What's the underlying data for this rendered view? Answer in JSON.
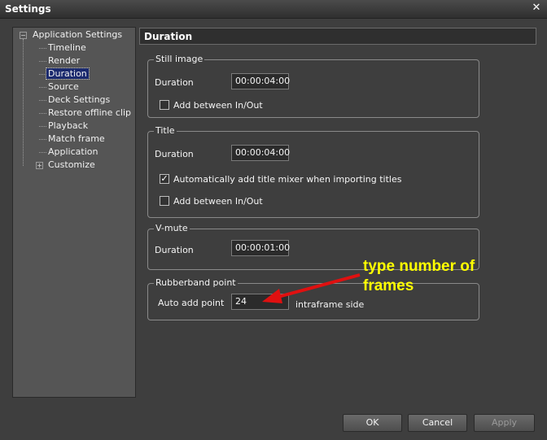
{
  "window": {
    "title": "Settings",
    "close_glyph": "✕"
  },
  "tree": {
    "root_label": "Application Settings",
    "items": [
      "Timeline",
      "Render",
      "Duration",
      "Source",
      "Deck Settings",
      "Restore offline clip",
      "Playback",
      "Match frame",
      "Application"
    ],
    "selected": "Duration",
    "customize_label": "Customize",
    "collapse_glyph": "−",
    "expand_glyph": "+"
  },
  "panel": {
    "header": "Duration"
  },
  "still_image": {
    "legend": "Still image",
    "duration_label": "Duration",
    "duration_value": "00:00:04:00",
    "add_between_label": "Add between In/Out",
    "add_between_checked": false
  },
  "title_group": {
    "legend": "Title",
    "duration_label": "Duration",
    "duration_value": "00:00:04:00",
    "auto_mixer_label": "Automatically add title mixer when importing titles",
    "auto_mixer_checked": true,
    "add_between_label": "Add between In/Out",
    "add_between_checked": false,
    "check_glyph": "✓"
  },
  "vmute": {
    "legend": "V-mute",
    "duration_label": "Duration",
    "duration_value": "00:00:01:00"
  },
  "rubberband": {
    "legend": "Rubberband point",
    "auto_add_label": "Auto add point",
    "auto_add_value": "24",
    "side_label": "intraframe side"
  },
  "annotation": {
    "text_line1": "type number of",
    "text_line2": "frames",
    "color": "#ffff00",
    "arrow_color": "#e01010"
  },
  "buttons": {
    "ok": "OK",
    "cancel": "Cancel",
    "apply": "Apply"
  }
}
